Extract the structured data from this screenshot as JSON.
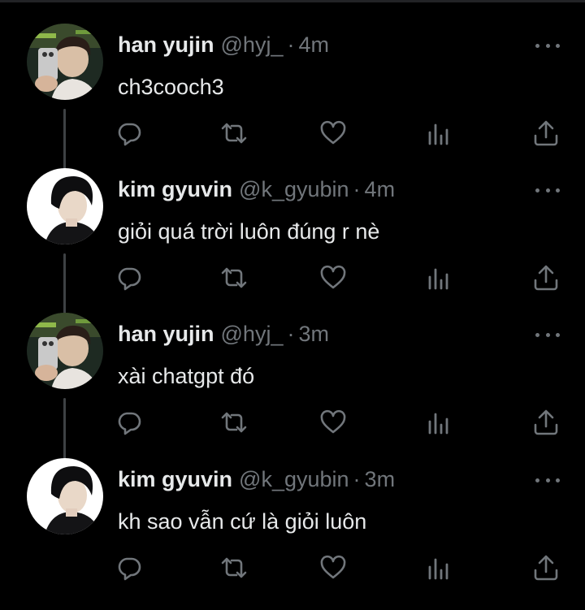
{
  "colors": {
    "background": "#000000",
    "primary_text": "#e7e9ea",
    "secondary_text": "#71767b",
    "thread_line": "#3e4144"
  },
  "icons": {
    "reply": "reply-icon",
    "retweet": "retweet-icon",
    "like": "like-icon",
    "views": "views-icon",
    "share": "share-icon",
    "more": "more-icon"
  },
  "tweets": [
    {
      "name": "han yujin",
      "handle": "@hyj_",
      "separator": "·",
      "time": "4m",
      "text": "ch3cooch3"
    },
    {
      "name": "kim gyuvin",
      "handle": "@k_gyubin",
      "separator": "·",
      "time": "4m",
      "text": "giỏi quá trời luôn đúng r nè"
    },
    {
      "name": "han yujin",
      "handle": "@hyj_",
      "separator": "·",
      "time": "3m",
      "text": "xài chatgpt đó"
    },
    {
      "name": "kim gyuvin",
      "handle": "@k_gyubin",
      "separator": "·",
      "time": "3m",
      "text": "kh sao vẫn cứ là giỏi luôn"
    }
  ]
}
